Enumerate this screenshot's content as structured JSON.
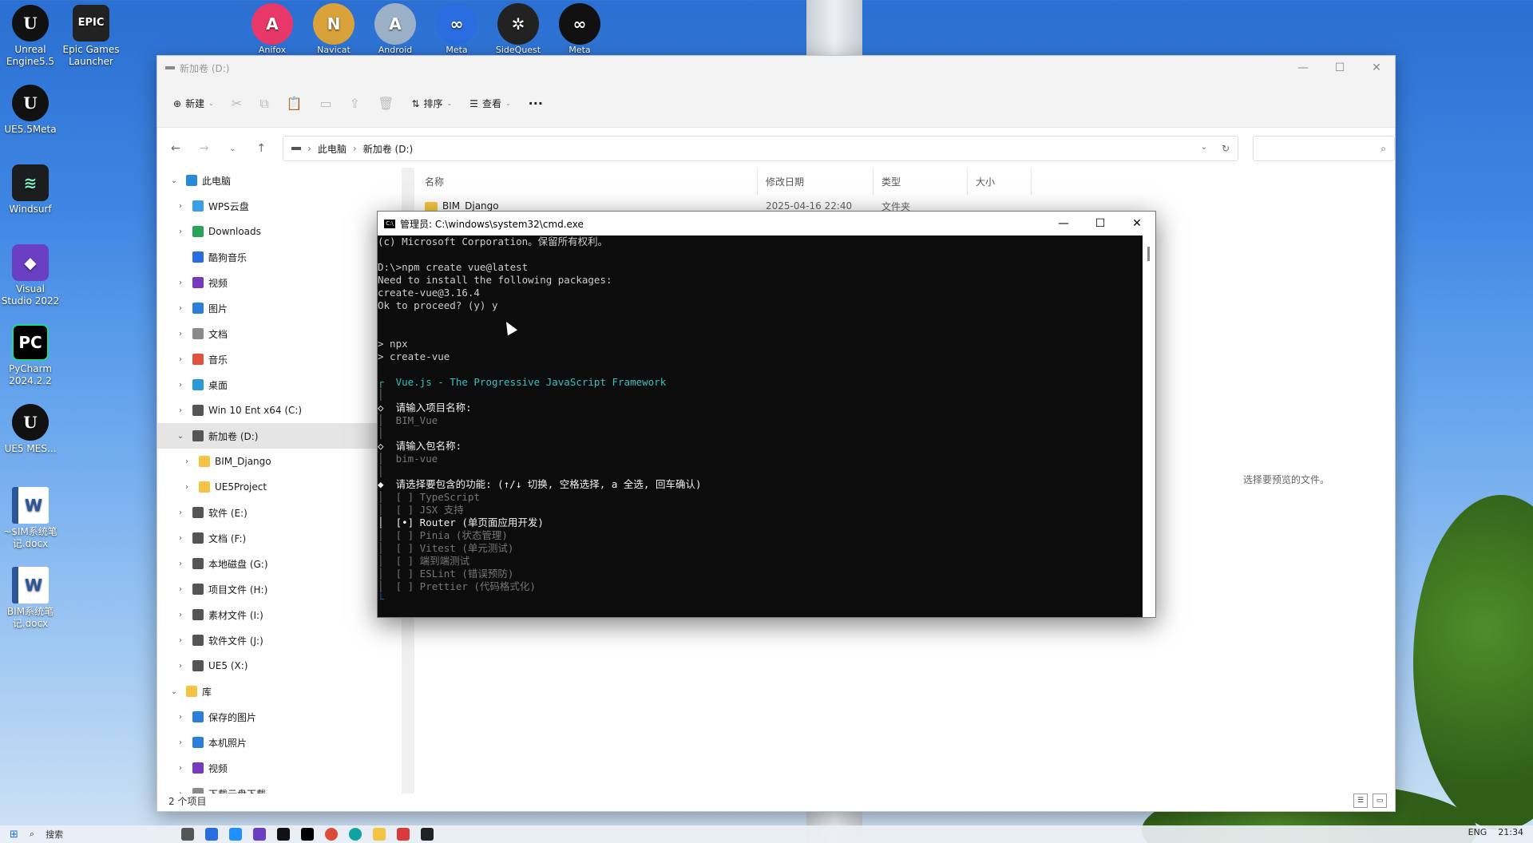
{
  "desktop": {
    "left_icons": [
      {
        "label": "Unreal Engine5.5",
        "glyph": "U",
        "kind": "ue"
      },
      {
        "label": "Epic Games Launcher",
        "glyph": "EPIC",
        "kind": "epic"
      },
      {
        "label": "UE5.5Meta",
        "glyph": "U",
        "kind": "ue"
      },
      {
        "label": "Windsurf",
        "glyph": "≋",
        "kind": "wind"
      },
      {
        "label": "Visual Studio 2022",
        "glyph": "◆",
        "kind": "vs"
      },
      {
        "label": "PyCharm 2024.2.2",
        "glyph": "PC",
        "kind": "pc"
      },
      {
        "label": "UE5 MES...",
        "glyph": "U",
        "kind": "ue"
      },
      {
        "label": "~$IM系统笔记.docx",
        "glyph": "W",
        "kind": "word"
      },
      {
        "label": "BIM系统笔记.docx",
        "glyph": "W",
        "kind": "word"
      }
    ],
    "top_icons": [
      {
        "label": "Anifox",
        "glyph": "A",
        "color": "#e8386a"
      },
      {
        "label": "Navicat",
        "glyph": "N",
        "color": "#d9a23a"
      },
      {
        "label": "Android",
        "glyph": "A",
        "color": "#9ab1c8"
      },
      {
        "label": "Meta Quest",
        "glyph": "∞",
        "color": "#2a6de0"
      },
      {
        "label": "SideQuest",
        "glyph": "✲",
        "color": "#222222"
      },
      {
        "label": "Meta Quest",
        "glyph": "∞",
        "color": "#111111"
      }
    ]
  },
  "explorer": {
    "title": "新加卷 (D:)",
    "toolbar": {
      "new_label": "新建",
      "sort_label": "排序",
      "view_label": "查看",
      "more_label": "···"
    },
    "breadcrumb": [
      "此电脑",
      "新加卷 (D:)"
    ],
    "search_placeholder": "",
    "sidebar": [
      {
        "label": "此电脑",
        "icon": "pc-icon",
        "expanded": true,
        "level": 0,
        "color": "#2a8ad8"
      },
      {
        "label": "WPS云盘",
        "icon": "cloud-icon",
        "level": 1,
        "color": "#3aa0e8"
      },
      {
        "label": "Downloads",
        "icon": "download-icon",
        "level": 1,
        "color": "#2aa35a"
      },
      {
        "label": "酷狗音乐",
        "icon": "kugou-icon",
        "level": 1,
        "color": "#2a6de0"
      },
      {
        "label": "视频",
        "icon": "video-icon",
        "level": 1,
        "color": "#7a3ac0"
      },
      {
        "label": "图片",
        "icon": "picture-icon",
        "level": 1,
        "color": "#2a80d8"
      },
      {
        "label": "文档",
        "icon": "document-icon",
        "level": 1,
        "color": "#8a8a8a"
      },
      {
        "label": "音乐",
        "icon": "music-icon",
        "level": 1,
        "color": "#e0503a"
      },
      {
        "label": "桌面",
        "icon": "desktop-icon",
        "level": 1,
        "color": "#2a9ad8"
      },
      {
        "label": "Win 10 Ent x64 (C:)",
        "icon": "drive-icon",
        "level": 1,
        "color": "#555555"
      },
      {
        "label": "新加卷 (D:)",
        "icon": "drive-icon",
        "level": 1,
        "expanded": true,
        "selected": true,
        "color": "#555555"
      },
      {
        "label": "BIM_Django",
        "icon": "folder-icon",
        "level": 2,
        "color": "#f5c542"
      },
      {
        "label": "UE5Project",
        "icon": "folder-icon",
        "level": 2,
        "color": "#f5c542"
      },
      {
        "label": "软件 (E:)",
        "icon": "drive-icon",
        "level": 1,
        "color": "#555555"
      },
      {
        "label": "文档 (F:)",
        "icon": "drive-icon",
        "level": 1,
        "color": "#555555"
      },
      {
        "label": "本地磁盘 (G:)",
        "icon": "drive-icon",
        "level": 1,
        "color": "#555555"
      },
      {
        "label": "项目文件 (H:)",
        "icon": "drive-icon",
        "level": 1,
        "color": "#555555"
      },
      {
        "label": "素材文件 (I:)",
        "icon": "drive-icon",
        "level": 1,
        "color": "#555555"
      },
      {
        "label": "软件文件 (J:)",
        "icon": "drive-icon",
        "level": 1,
        "color": "#555555"
      },
      {
        "label": "UE5 (X:)",
        "icon": "drive-icon",
        "level": 1,
        "color": "#555555"
      },
      {
        "label": "库",
        "icon": "library-icon",
        "level": 0,
        "expanded": true,
        "color": "#f5c542"
      },
      {
        "label": "保存的图片",
        "icon": "picture-icon",
        "level": 1,
        "color": "#2a80d8"
      },
      {
        "label": "本机照片",
        "icon": "picture-icon",
        "level": 1,
        "color": "#2a80d8"
      },
      {
        "label": "视频",
        "icon": "video-icon",
        "level": 1,
        "color": "#7a3ac0"
      },
      {
        "label": "下载云盘下载",
        "icon": "document-icon",
        "level": 1,
        "color": "#8a8a8a"
      }
    ],
    "columns": [
      "名称",
      "修改日期",
      "类型",
      "大小"
    ],
    "files": [
      {
        "name": "BIM_Django",
        "date": "2025-04-16 22:40",
        "type": "文件夹",
        "size": ""
      }
    ],
    "preview_text": "选择要预览的文件。",
    "status": "2 个项目"
  },
  "cmd": {
    "title": "管理员: C:\\windows\\system32\\cmd.exe",
    "lines": [
      {
        "t": "(c) Microsoft Corporation。保留所有权利。",
        "c": ""
      },
      {
        "t": "",
        "c": ""
      },
      {
        "t": "D:\\>npm create vue@latest",
        "c": ""
      },
      {
        "t": "Need to install the following packages:",
        "c": ""
      },
      {
        "t": "create-vue@3.16.4",
        "c": ""
      },
      {
        "t": "Ok to proceed? (y) y",
        "c": ""
      },
      {
        "t": "",
        "c": ""
      },
      {
        "t": "",
        "c": ""
      },
      {
        "t": "> npx",
        "c": ""
      },
      {
        "t": "> create-vue",
        "c": ""
      },
      {
        "t": "",
        "c": ""
      },
      {
        "t": "┌  Vue.js - The Progressive JavaScript Framework",
        "c": "c-cyan"
      },
      {
        "t": "│",
        "c": "c-gray"
      },
      {
        "t": "◇  请输入项目名称:",
        "c": "c-white"
      },
      {
        "t": "│  BIM_Vue",
        "c": "c-gray"
      },
      {
        "t": "│",
        "c": "c-gray"
      },
      {
        "t": "◇  请输入包名称:",
        "c": "c-white"
      },
      {
        "t": "│  bim-vue",
        "c": "c-gray"
      },
      {
        "t": "│",
        "c": "c-gray"
      },
      {
        "t": "◆  请选择要包含的功能: (↑/↓ 切换, 空格选择, a 全选, 回车确认)",
        "c": "c-white"
      },
      {
        "t": "│  [ ] TypeScript",
        "c": "c-gray"
      },
      {
        "t": "│  [ ] JSX 支持",
        "c": "c-gray"
      },
      {
        "t": "│  [•] Router (单页面应用开发)",
        "c": "c-white"
      },
      {
        "t": "│  [ ] Pinia (状态管理)",
        "c": "c-gray"
      },
      {
        "t": "│  [ ] Vitest (单元测试)",
        "c": "c-gray"
      },
      {
        "t": "│  [ ] 端到端测试",
        "c": "c-gray"
      },
      {
        "t": "│  [ ] ESLint (错误预防)",
        "c": "c-gray"
      },
      {
        "t": "│  [ ] Prettier (代码格式化)",
        "c": "c-gray"
      },
      {
        "t": "└",
        "c": "c-dimblue"
      }
    ]
  },
  "taskbar": {
    "search_label": "搜索",
    "time": "21:34",
    "lang": "ENG"
  }
}
